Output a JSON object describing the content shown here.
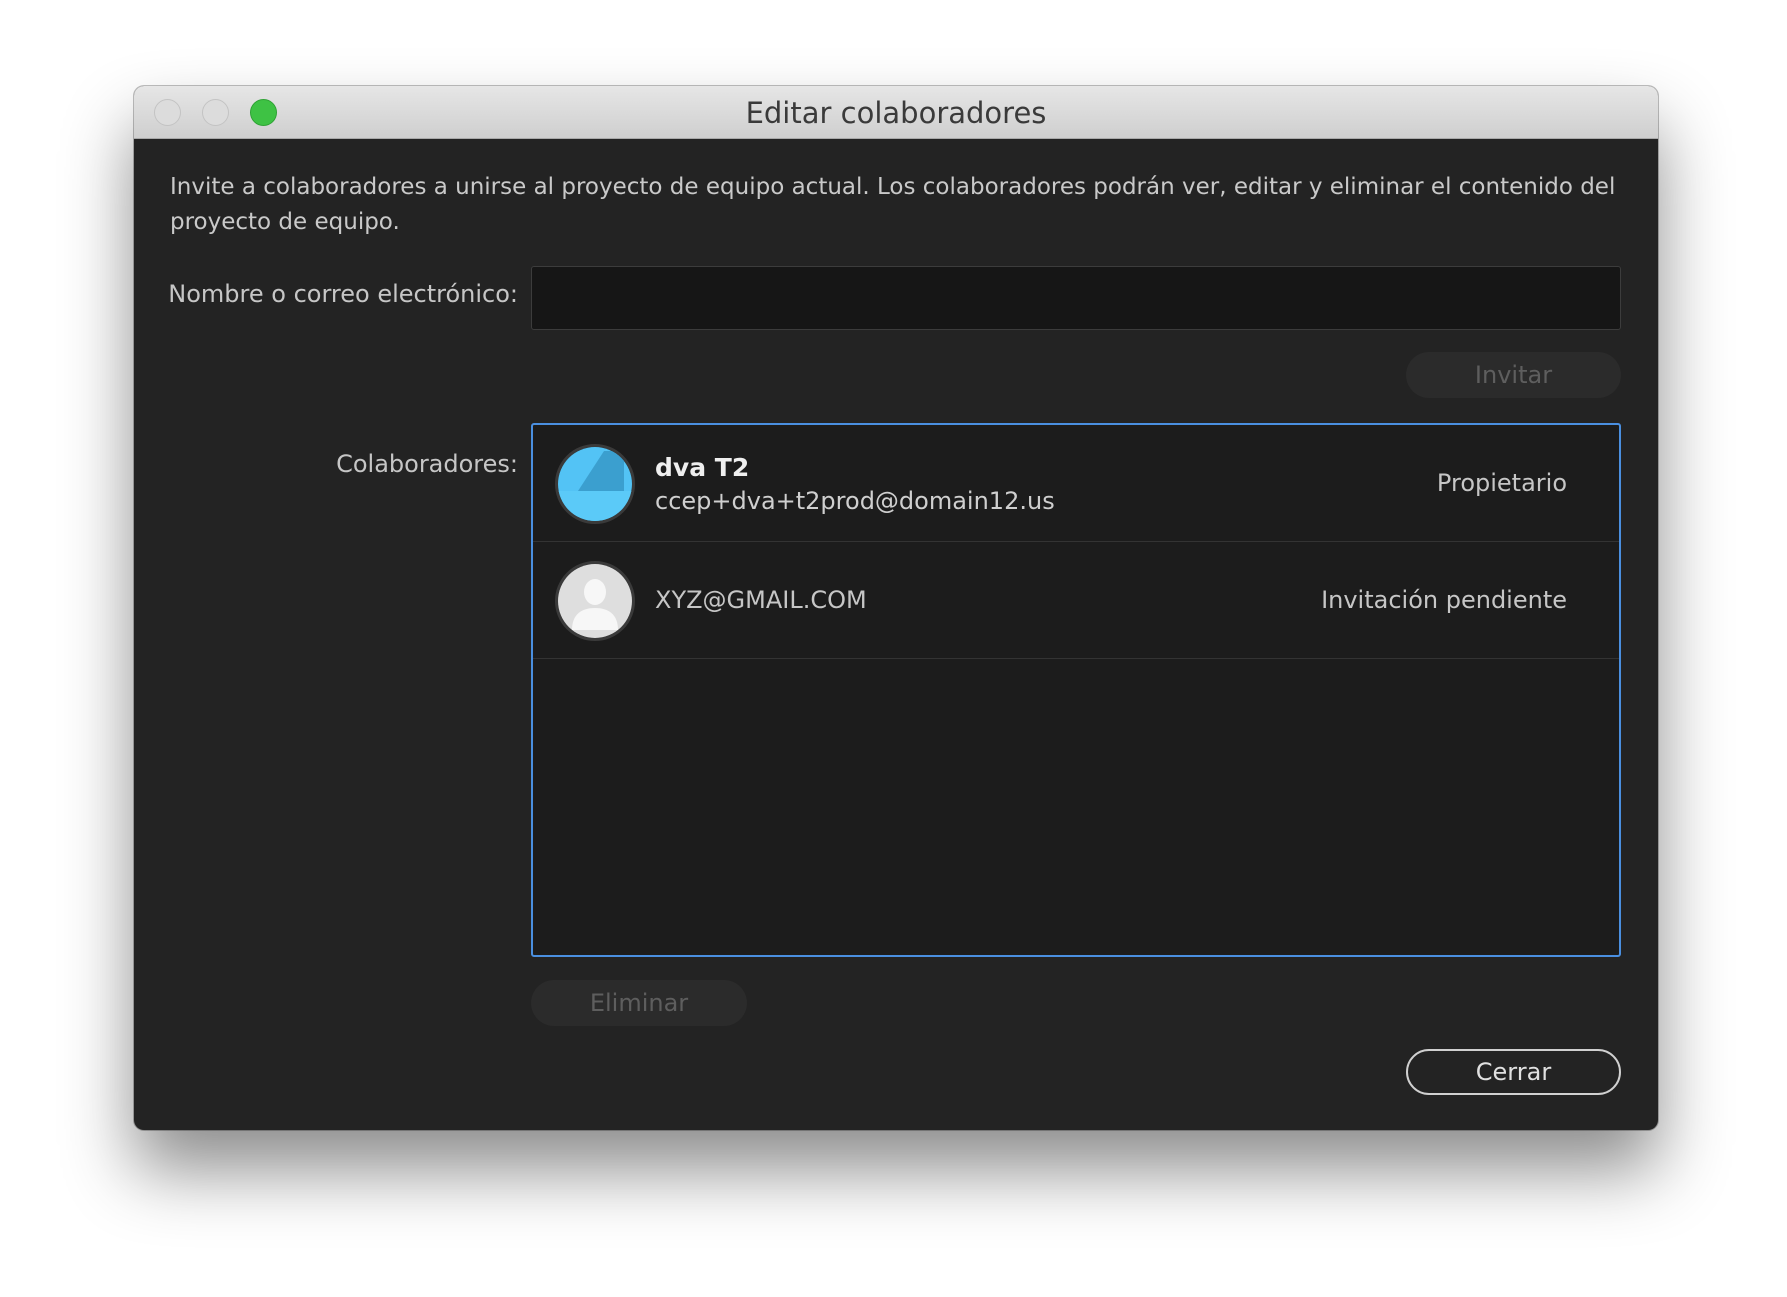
{
  "window": {
    "title": "Editar colaboradores"
  },
  "description": "Invite a colaboradores a unirse al proyecto de equipo actual. Los colaboradores podrán ver, editar y eliminar el contenido del proyecto de equipo.",
  "invite": {
    "label": "Nombre o correo electrónico:",
    "input_value": "",
    "button_label": "Invitar"
  },
  "collaborators": {
    "label": "Colaboradores:",
    "items": [
      {
        "name": "dva T2",
        "email": "ccep+dva+t2prod@domain12.us",
        "role": "Propietario",
        "avatar_icon": "user-avatar-icon",
        "avatar_color": "#53c3f5"
      },
      {
        "email": "XYZ@GMAIL.COM",
        "role": "Invitación pendiente",
        "avatar_icon": "default-person-icon"
      }
    ]
  },
  "actions": {
    "delete_label": "Eliminar",
    "close_label": "Cerrar"
  },
  "colors": {
    "background": "#232323",
    "list_border": "#4a8fe0",
    "zoom_button": "#3ec244"
  }
}
